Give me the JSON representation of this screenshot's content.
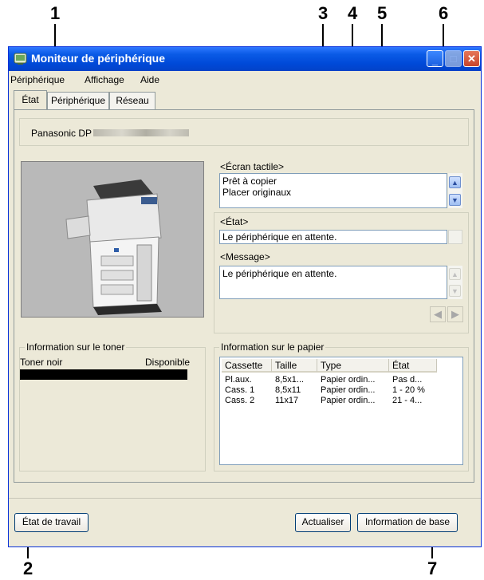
{
  "callouts": {
    "c1": "1",
    "c2": "2",
    "c3": "3",
    "c4": "4",
    "c5": "5",
    "c6": "6",
    "c7": "7"
  },
  "window": {
    "title": "Moniteur de périphérique"
  },
  "menu": {
    "items": [
      "Périphérique",
      "Affichage",
      "Aide"
    ]
  },
  "tabs": [
    "État",
    "Périphérique",
    "Réseau"
  ],
  "device": {
    "name": "Panasonic DP"
  },
  "touchscreen": {
    "label": "<Écran tactile>",
    "lines": [
      "Prêt à copier",
      "Placer originaux"
    ]
  },
  "status": {
    "label": "<État>",
    "value": "Le périphérique en attente."
  },
  "message": {
    "label": "<Message>",
    "value": "Le périphérique en attente."
  },
  "toner": {
    "legend": "Information sur le toner",
    "name": "Toner noir",
    "state": "Disponible",
    "level": 1.0
  },
  "paper": {
    "legend": "Information sur le papier",
    "columns": [
      "Cassette",
      "Taille",
      "Type",
      "État"
    ],
    "rows": [
      [
        "Pl.aux.",
        "8,5x1...",
        "Papier ordin...",
        "Pas d..."
      ],
      [
        "Cass. 1",
        "8,5x11",
        "Papier ordin...",
        "1 - 20 %"
      ],
      [
        "Cass. 2",
        "11x17",
        "Papier ordin...",
        "21 - 4..."
      ]
    ]
  },
  "buttons": {
    "job_status": "État de travail",
    "refresh": "Actualiser",
    "base_info": "Information de base"
  },
  "colors": {
    "titlebar": "#0a5be6",
    "window_bg": "#ece9d8",
    "close": "#c8452a"
  }
}
